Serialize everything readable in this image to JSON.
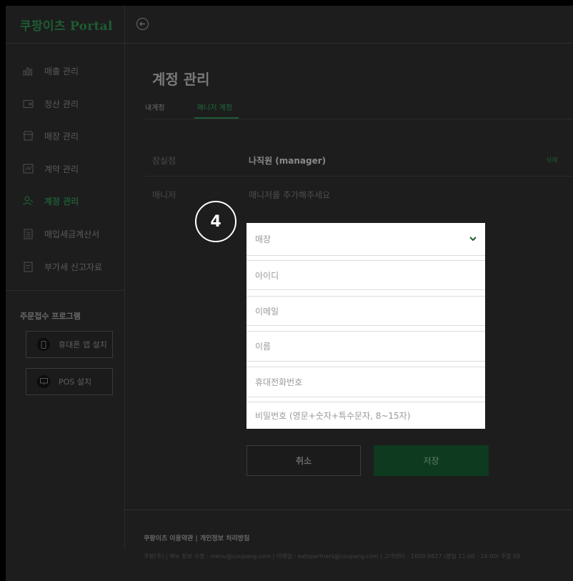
{
  "app": {
    "logo": "쿠팡이츠 Portal"
  },
  "sidebar": {
    "items": [
      {
        "label": "매출 관리",
        "icon": "bar-chart-icon"
      },
      {
        "label": "정산 관리",
        "icon": "wallet-icon"
      },
      {
        "label": "매장 관리",
        "icon": "store-icon"
      },
      {
        "label": "계약 관리",
        "icon": "contract-icon"
      },
      {
        "label": "계정 관리",
        "icon": "person-icon",
        "active": true
      },
      {
        "label": "매입세금계산서",
        "icon": "receipt-icon"
      },
      {
        "label": "부가세 신고자료",
        "icon": "document-icon"
      }
    ],
    "section_title": "주문접수 프로그램",
    "buttons": [
      {
        "label": "휴대폰 앱 설치",
        "icon": "phone-icon"
      },
      {
        "label": "POS 설치",
        "icon": "monitor-icon"
      }
    ]
  },
  "page": {
    "title": "계정 관리",
    "tabs": [
      {
        "label": "내계정",
        "active": false
      },
      {
        "label": "매니저 계정",
        "active": true
      }
    ],
    "rows": [
      {
        "label": "잠실점",
        "value": "나직원 (manager)",
        "action": "삭제"
      },
      {
        "label": "매니저",
        "value": "매니저를 추가해주세요"
      }
    ]
  },
  "step_badge": "4",
  "form": {
    "store_select_placeholder": "매장",
    "id_placeholder": "아이디",
    "email_placeholder": "이메일",
    "name_placeholder": "이름",
    "phone_placeholder": "휴대전화번호",
    "password_placeholder": "비밀번호 (영문+숫자+특수문자, 8~15자)"
  },
  "actions": {
    "cancel": "취소",
    "save": "저장"
  },
  "footer": {
    "links": "쿠팡이츠 이용약관  |  개인정보 처리방침",
    "info": "쿠팡(주)  |  메뉴 정보 수정 : menu@coupang.com  |  이메일 : eatspartners@coupang.com  |  고객센터 : 1600-9827 (평일 11:00 - 24:00/ 주말 09"
  },
  "colors": {
    "brand": "#1e5b33",
    "save": "#0e3a20"
  }
}
